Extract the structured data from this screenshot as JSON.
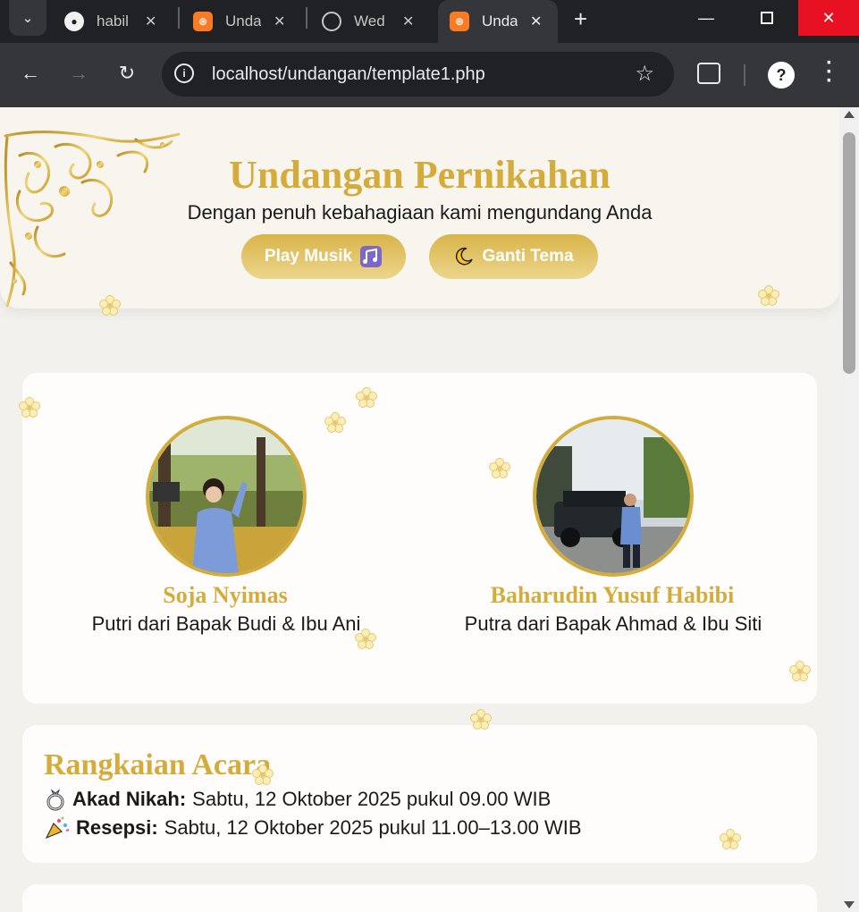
{
  "browser": {
    "tabs": [
      {
        "title": "habil",
        "favicon": "github-icon"
      },
      {
        "title": "Unda",
        "favicon": "xampp-icon"
      },
      {
        "title": "Wed",
        "favicon": "globe-icon"
      },
      {
        "title": "Unda",
        "favicon": "xampp-icon",
        "active": true
      }
    ],
    "url": "localhost/undangan/template1.php"
  },
  "hero": {
    "title": "Undangan Pernikahan",
    "subtitle": "Dengan penuh kebahagiaan kami mengundang Anda",
    "play_button": "Play Musik",
    "theme_button": "Ganti Tema"
  },
  "couple": {
    "bride": {
      "name": "Soja Nyimas",
      "parents": "Putri dari Bapak Budi & Ibu Ani"
    },
    "groom": {
      "name": "Baharudin Yusuf Habibi",
      "parents": "Putra dari Bapak Ahmad & Ibu Siti"
    }
  },
  "events": {
    "title": "Rangkaian Acara",
    "items": [
      {
        "label": "Akad Nikah:",
        "detail": "Sabtu, 12 Oktober 2025 pukul 09.00 WIB",
        "icon": "ring-icon"
      },
      {
        "label": "Resepsi:",
        "detail": "Sabtu, 12 Oktober 2025 pukul 11.00–13.00 WIB",
        "icon": "party-popper-icon"
      }
    ]
  },
  "colors": {
    "accent": "#d4ac3c",
    "page_bg": "#f3f1ee",
    "card_bg": "#fffdfb"
  }
}
